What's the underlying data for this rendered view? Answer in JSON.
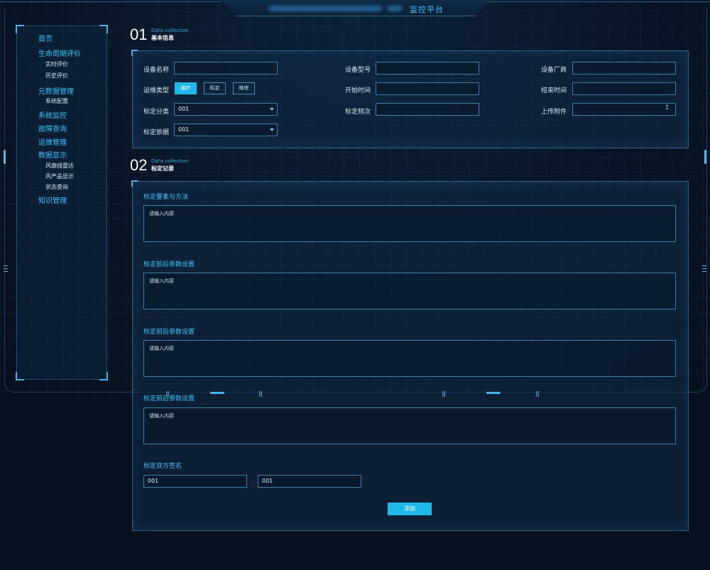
{
  "header": {
    "title": "监控平台"
  },
  "sidebar": {
    "items": [
      {
        "label": "首页",
        "children": []
      },
      {
        "label": "生命周期评价",
        "children": [
          "实时评价",
          "历史评价"
        ]
      },
      {
        "label": "元数据管理",
        "children": [
          "系统配置"
        ]
      },
      {
        "label": "系统监控",
        "children": []
      },
      {
        "label": "故障查询",
        "children": []
      },
      {
        "label": "运维管理",
        "children": []
      },
      {
        "label": "数据显示",
        "children": [
          "风廓线雷达",
          "风产品显示",
          "状态查询"
        ]
      },
      {
        "label": "知识管理",
        "children": []
      }
    ]
  },
  "section1": {
    "num": "01",
    "en": "Data collection",
    "cn": "基本信息"
  },
  "section2": {
    "num": "02",
    "en": "Data collection",
    "cn": "标定记录"
  },
  "form": {
    "device_name_label": "设备名称",
    "device_model_label": "设备型号",
    "vendor_label": "设备厂商",
    "ops_type_label": "运维类型",
    "ops_types": [
      "维护",
      "标定",
      "维修"
    ],
    "start_time_label": "开始时间",
    "end_time_label": "结束时间",
    "calib_class_label": "标定分类",
    "calib_class_value": "001",
    "calib_freq_label": "标定频次",
    "upload_label": "上传附件",
    "calib_basis_label": "标定依据",
    "calib_basis_value": "001"
  },
  "records": {
    "areas": [
      {
        "label": "标定要素与方法",
        "placeholder": "请输入内容"
      },
      {
        "label": "标定前后参数设置",
        "placeholder": "请输入内容"
      },
      {
        "label": "标定前后参数设置",
        "placeholder": "请输入内容"
      },
      {
        "label": "标定前后参数设置",
        "placeholder": "请输入内容"
      }
    ],
    "signature_label": "标定双方签名",
    "sign_a": "001",
    "sign_b": "001",
    "add_label": "添加"
  }
}
